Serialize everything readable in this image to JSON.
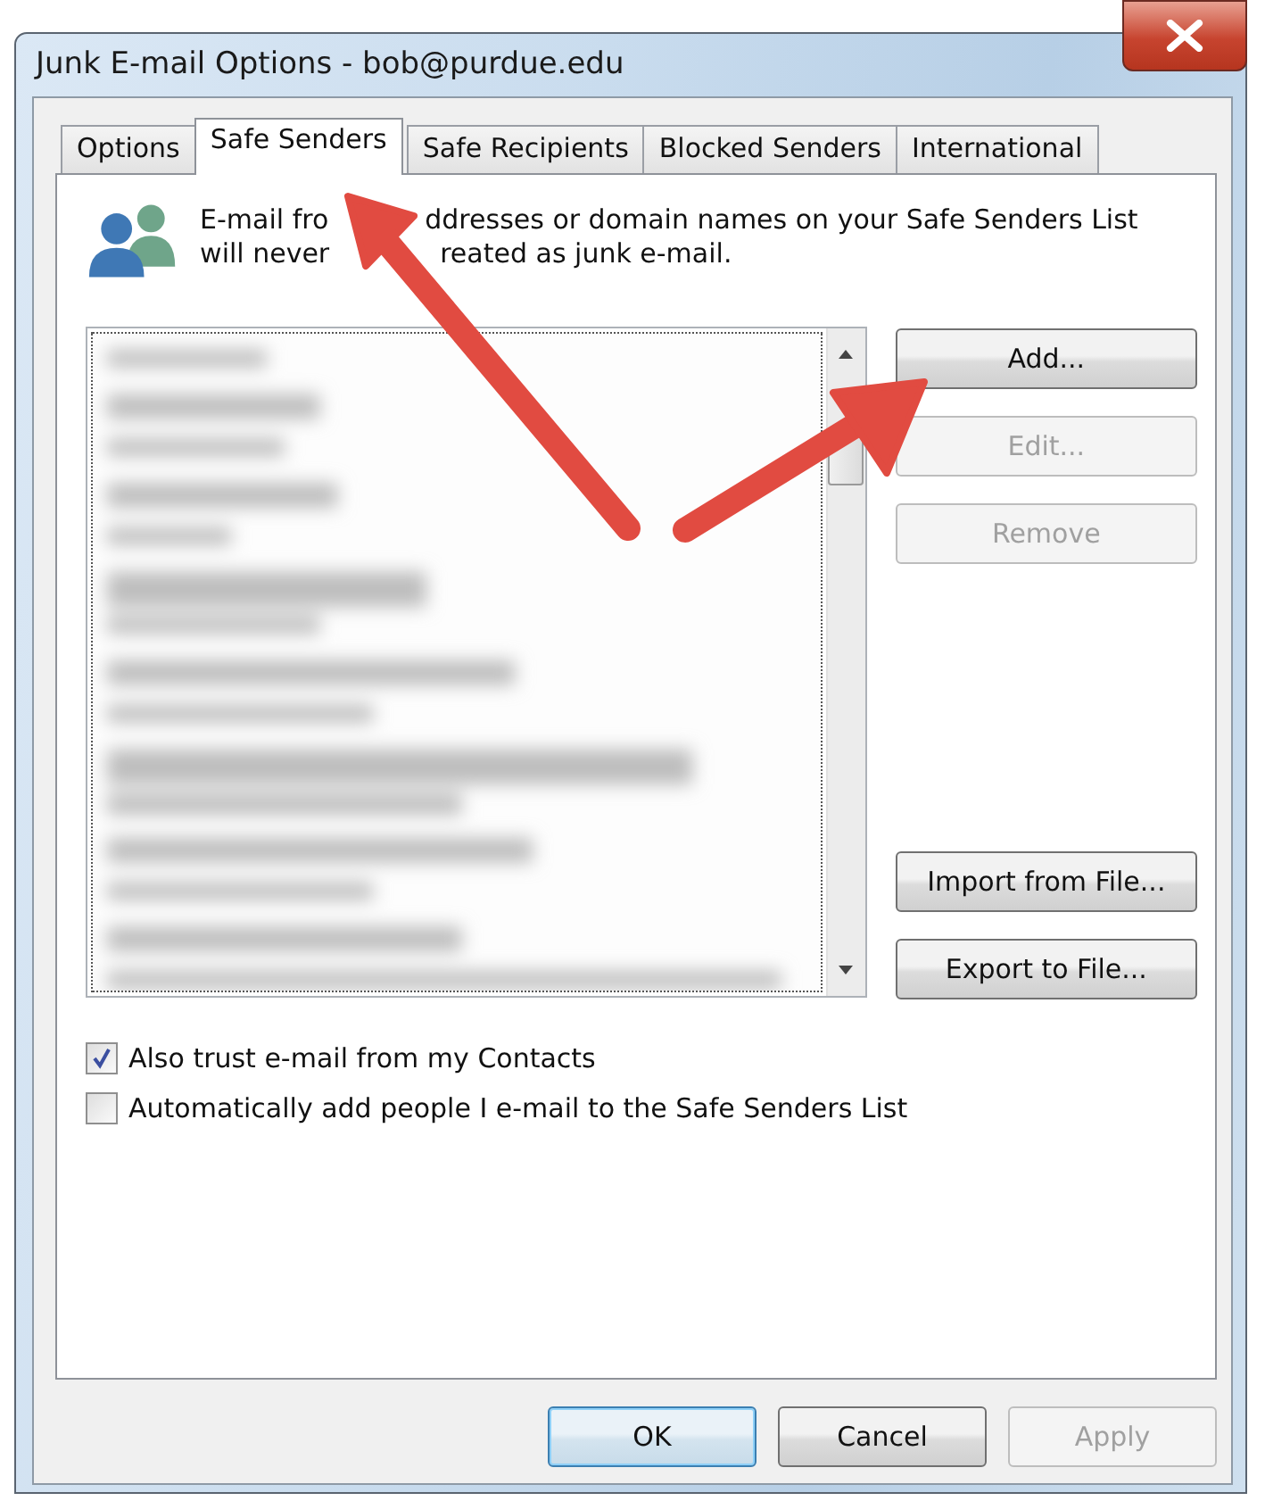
{
  "window": {
    "title": "Junk E-mail Options - bob@purdue.edu"
  },
  "tabs": [
    {
      "label": "Options",
      "selected": false
    },
    {
      "label": "Safe Senders",
      "selected": true
    },
    {
      "label": "Safe Recipients",
      "selected": false
    },
    {
      "label": "Blocked Senders",
      "selected": false
    },
    {
      "label": "International",
      "selected": false
    }
  ],
  "description_lines": [
    [
      "E-mail fro",
      "ddresses or domain names on your Safe Senders List"
    ],
    [
      "will never",
      "reated as junk e-mail."
    ]
  ],
  "list_buttons": [
    {
      "label": "Add...",
      "disabled": false
    },
    {
      "label": "Edit...",
      "disabled": true
    },
    {
      "label": "Remove",
      "disabled": true
    }
  ],
  "file_buttons": [
    {
      "label": "Import from File...",
      "disabled": false
    },
    {
      "label": "Export to File...",
      "disabled": false
    }
  ],
  "options": [
    {
      "label": "Also trust e-mail from my Contacts",
      "checked": true
    },
    {
      "label": "Automatically add people I e-mail to the Safe Senders List",
      "checked": false
    }
  ],
  "dialog_buttons": [
    {
      "label": "OK",
      "disabled": false,
      "default": true
    },
    {
      "label": "Cancel",
      "disabled": false,
      "default": false
    },
    {
      "label": "Apply",
      "disabled": true,
      "default": false
    }
  ]
}
